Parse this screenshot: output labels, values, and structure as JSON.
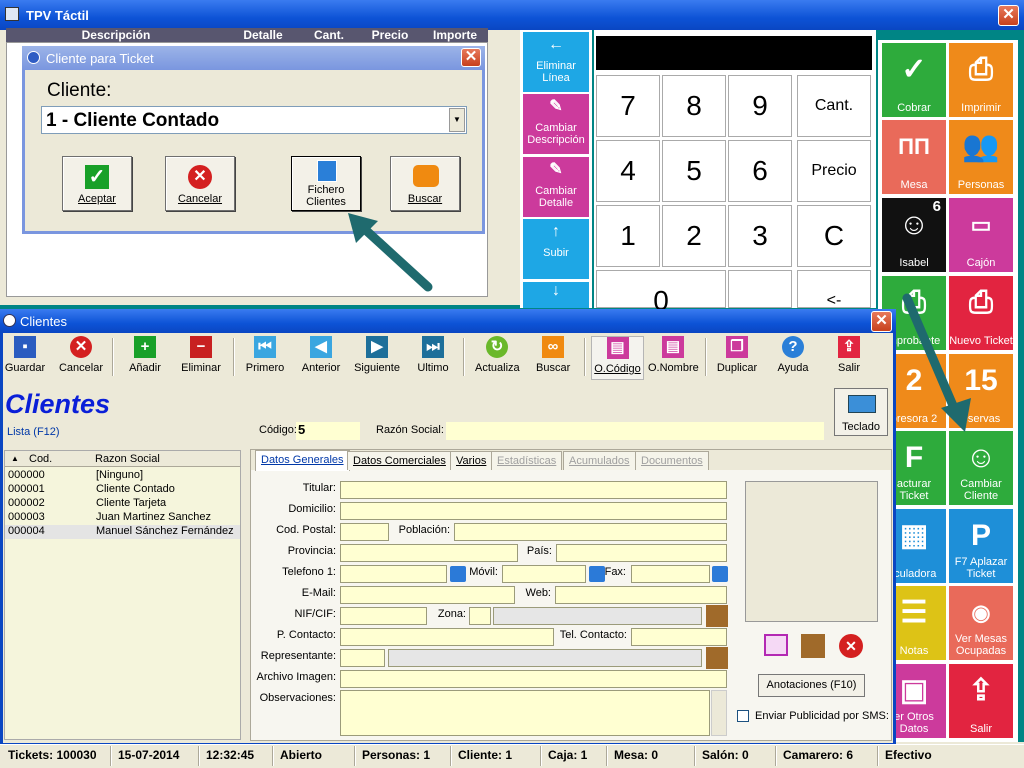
{
  "main_window": {
    "title": "TPV Táctil"
  },
  "ticket_columns": [
    "Descripción",
    "Detalle",
    "Cant.",
    "Precio",
    "Importe"
  ],
  "cliente_dialog": {
    "title": "Cliente para Ticket",
    "cliente_label": "Cliente:",
    "cliente_value": "1 - Cliente Contado",
    "buttons": {
      "aceptar": "Aceptar",
      "cancelar": "Cancelar",
      "fichero_line1": "Fichero",
      "fichero_line2": "Clientes",
      "buscar": "Buscar"
    }
  },
  "edit_buttons": [
    {
      "line1": "Eliminar",
      "line2": "Línea",
      "icon": "arrow-left-icon",
      "color": "#1ea7e5"
    },
    {
      "line1": "Cambiar",
      "line2": "Descripción",
      "icon": "pencil-icon",
      "color": "#cc3a9c"
    },
    {
      "line1": "Cambiar",
      "line2": "Detalle",
      "icon": "pencil-icon",
      "color": "#cc3a9c"
    },
    {
      "line1": "Subir",
      "line2": "",
      "icon": "arrow-up-icon",
      "color": "#1ea7e5"
    },
    {
      "line1": "",
      "line2": "",
      "icon": "arrow-down-icon",
      "color": "#1ea7e5"
    }
  ],
  "keypad": {
    "k7": "7",
    "k8": "8",
    "k9": "9",
    "cant": "Cant.",
    "k4": "4",
    "k5": "5",
    "k6": "6",
    "precio": "Precio",
    "k1": "1",
    "k2": "2",
    "k3": "3",
    "c": "C",
    "k0": "0",
    "back": "<-"
  },
  "tiles": {
    "cobrar": "Cobrar",
    "imprimir": "Imprimir",
    "mesa": "Mesa",
    "personas": "Personas",
    "isabel": "Isabel",
    "isabel_count": "6",
    "cajon": "Cajón",
    "comprobante": "mprobante",
    "nuevo_ticket": "Nuevo Ticket",
    "impresora": "presora 2",
    "reservas": "eservas",
    "reservas_day": "15",
    "facturar_1": "acturar",
    "facturar_2": "Ticket",
    "cambiar_cliente_1": "Cambiar",
    "cambiar_cliente_2": "Cliente",
    "calculadora": "lculadora",
    "aplazar_1": "F7 Aplazar",
    "aplazar_2": "Ticket",
    "notas": "Notas",
    "ver_mesas_1": "Ver Mesas",
    "ver_mesas_2": "Ocupadas",
    "otros_1": "er Otros",
    "otros_2": "Datos",
    "salir": "Salir"
  },
  "clientes_window": {
    "title": "Clientes",
    "heading": "Clientes",
    "lista_label": "Lista (F12)",
    "teclado": "Teclado",
    "toolbar": {
      "guardar": "Guardar",
      "cancelar": "Cancelar",
      "anadir": "Añadir",
      "eliminar": "Eliminar",
      "primero": "Primero",
      "anterior": "Anterior",
      "siguiente": "Siguiente",
      "ultimo": "Ultimo",
      "actualiza": "Actualiza",
      "buscar": "Buscar",
      "ocodigo": "O.Código",
      "onombre": "O.Nombre",
      "duplicar": "Duplicar",
      "ayuda": "Ayuda",
      "salir": "Salir"
    },
    "codigo_label": "Código:",
    "codigo_value": "5",
    "razon_label": "Razón Social:",
    "list_headers": [
      "Cod.",
      "Razon Social"
    ],
    "list_rows": [
      {
        "cod": "000000",
        "name": "[Ninguno]"
      },
      {
        "cod": "000001",
        "name": "Cliente Contado"
      },
      {
        "cod": "000002",
        "name": "Cliente Tarjeta"
      },
      {
        "cod": "000003",
        "name": "Juan Martinez Sanchez"
      },
      {
        "cod": "000004",
        "name": "Manuel Sánchez Fernández"
      }
    ],
    "tabs": [
      "Datos Generales",
      "Datos Comerciales",
      "Varios",
      "Estadísticas",
      "Acumulados",
      "Documentos"
    ],
    "form_labels": {
      "titular": "Titular:",
      "domicilio": "Domicilio:",
      "cod_postal": "Cod. Postal:",
      "poblacion": "Población:",
      "provincia": "Provincia:",
      "pais": "País:",
      "telefono": "Telefono 1:",
      "movil": "Móvil:",
      "fax": "Fax:",
      "email": "E-Mail:",
      "web": "Web:",
      "nif": "NIF/CIF:",
      "zona": "Zona:",
      "p_contacto": "P. Contacto:",
      "tel_contacto": "Tel. Contacto:",
      "representante": "Representante:",
      "archivo_imagen": "Archivo Imagen:",
      "observaciones": "Observaciones:"
    },
    "anotaciones": "Anotaciones (F10)",
    "publicidad": "Enviar Publicidad por SMS:"
  },
  "statusbar": {
    "tickets": "Tickets: 100030",
    "fecha": "15-07-2014",
    "hora": "12:32:45",
    "estado": "Abierto",
    "personas": "Personas: 1",
    "cliente": "Cliente: 1",
    "caja": "Caja: 1",
    "mesa": "Mesa: 0",
    "salon": "Salón: 0",
    "camarero": "Camarero: 6",
    "pago": "Efectivo"
  }
}
